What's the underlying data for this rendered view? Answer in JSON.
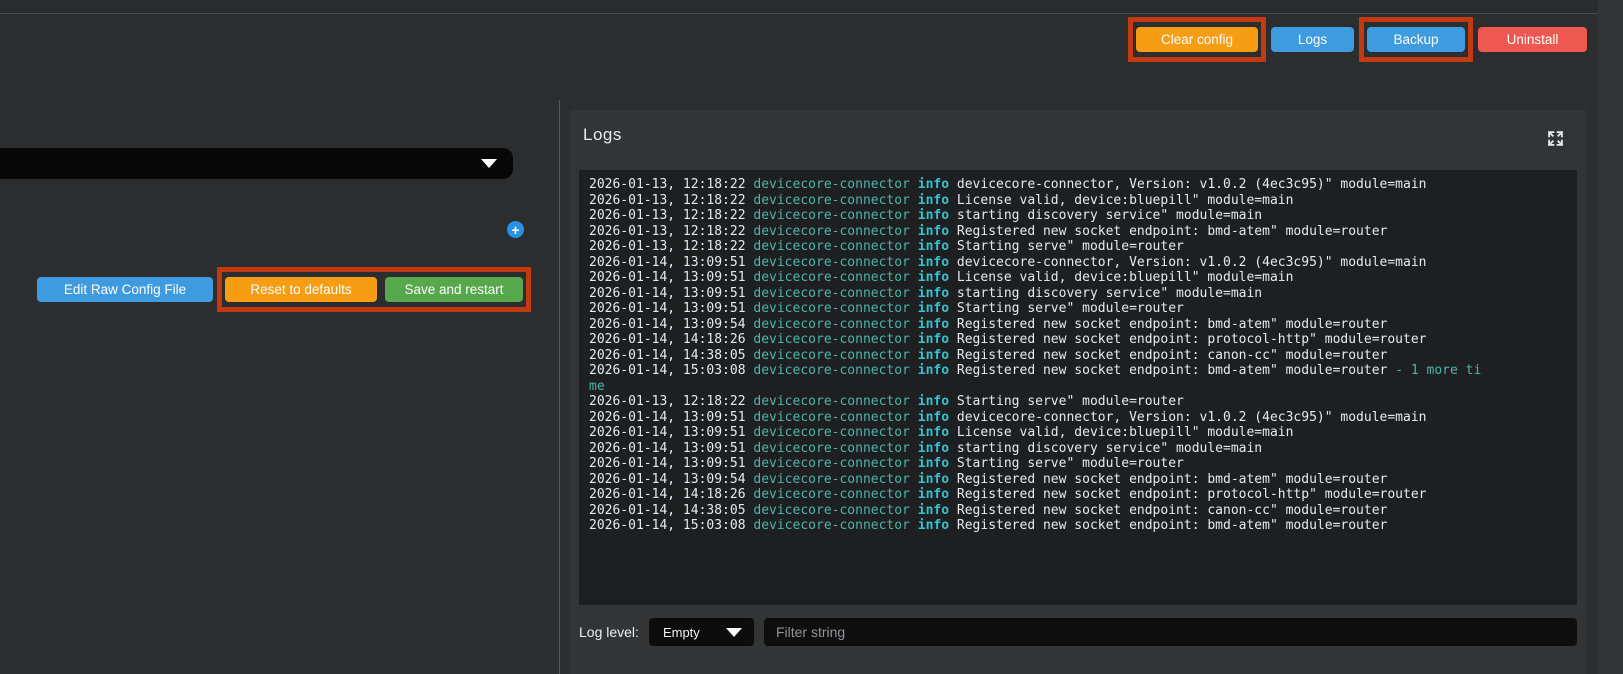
{
  "topbar": {
    "buttons": [
      {
        "label": "Clear config",
        "color": "#f79d13",
        "annotated": true
      },
      {
        "label": "Logs",
        "color": "#3f9be0",
        "annotated": false
      },
      {
        "label": "Backup",
        "color": "#3f9be0",
        "annotated": true
      },
      {
        "label": "Uninstall",
        "color": "#ef5850",
        "annotated": false
      }
    ]
  },
  "config": {
    "dropdown_icon": "chevron-down-icon",
    "add_icon": "plus-icon",
    "add_symbol": "+",
    "actions": [
      {
        "label": "Edit Raw Config File",
        "color": "#3f9be0",
        "annotated": false
      },
      {
        "label": "Reset to defaults",
        "color": "#f79d13",
        "annotated": true
      },
      {
        "label": "Save and restart",
        "color": "#57a84c",
        "annotated": true
      }
    ]
  },
  "logs": {
    "title": "Logs",
    "expand_icon": "expand-arrows-icon",
    "level_label": "Log level:",
    "level_value": "Empty",
    "filter_placeholder": "Filter string",
    "entries": [
      {
        "ts": "2026-01-13, 12:18:22",
        "src": "devicecore-connector",
        "lvl": "info",
        "msg": "devicecore-connector, Version: v1.0.2 (4ec3c95)\" module=main"
      },
      {
        "ts": "2026-01-13, 12:18:22",
        "src": "devicecore-connector",
        "lvl": "info",
        "msg": "License valid, device:bluepill\" module=main"
      },
      {
        "ts": "2026-01-13, 12:18:22",
        "src": "devicecore-connector",
        "lvl": "info",
        "msg": "starting discovery service\" module=main"
      },
      {
        "ts": "2026-01-13, 12:18:22",
        "src": "devicecore-connector",
        "lvl": "info",
        "msg": "Registered new socket endpoint: bmd-atem\" module=router"
      },
      {
        "ts": "2026-01-13, 12:18:22",
        "src": "devicecore-connector",
        "lvl": "info",
        "msg": "Starting serve\" module=router"
      },
      {
        "ts": "2026-01-14, 13:09:51",
        "src": "devicecore-connector",
        "lvl": "info",
        "msg": "devicecore-connector, Version: v1.0.2 (4ec3c95)\" module=main"
      },
      {
        "ts": "2026-01-14, 13:09:51",
        "src": "devicecore-connector",
        "lvl": "info",
        "msg": "License valid, device:bluepill\" module=main"
      },
      {
        "ts": "2026-01-14, 13:09:51",
        "src": "devicecore-connector",
        "lvl": "info",
        "msg": "starting discovery service\" module=main"
      },
      {
        "ts": "2026-01-14, 13:09:51",
        "src": "devicecore-connector",
        "lvl": "info",
        "msg": "Starting serve\" module=router"
      },
      {
        "ts": "2026-01-14, 13:09:54",
        "src": "devicecore-connector",
        "lvl": "info",
        "msg": "Registered new socket endpoint: bmd-atem\" module=router"
      },
      {
        "ts": "2026-01-14, 14:18:26",
        "src": "devicecore-connector",
        "lvl": "info",
        "msg": "Registered new socket endpoint: protocol-http\" module=router"
      },
      {
        "ts": "2026-01-14, 14:38:05",
        "src": "devicecore-connector",
        "lvl": "info",
        "msg": "Registered new socket endpoint: canon-cc\" module=router"
      },
      {
        "ts": "2026-01-14, 15:03:08",
        "src": "devicecore-connector",
        "lvl": "info",
        "msg": "Registered new socket endpoint: bmd-atem\" module=router",
        "extra": "- 1 more ti"
      },
      {
        "cont": "me"
      },
      {
        "ts": "2026-01-13, 12:18:22",
        "src": "devicecore-connector",
        "lvl": "info",
        "msg": "Starting serve\" module=router"
      },
      {
        "ts": "2026-01-14, 13:09:51",
        "src": "devicecore-connector",
        "lvl": "info",
        "msg": "devicecore-connector, Version: v1.0.2 (4ec3c95)\" module=main"
      },
      {
        "ts": "2026-01-14, 13:09:51",
        "src": "devicecore-connector",
        "lvl": "info",
        "msg": "License valid, device:bluepill\" module=main"
      },
      {
        "ts": "2026-01-14, 13:09:51",
        "src": "devicecore-connector",
        "lvl": "info",
        "msg": "starting discovery service\" module=main"
      },
      {
        "ts": "2026-01-14, 13:09:51",
        "src": "devicecore-connector",
        "lvl": "info",
        "msg": "Starting serve\" module=router"
      },
      {
        "ts": "2026-01-14, 13:09:54",
        "src": "devicecore-connector",
        "lvl": "info",
        "msg": "Registered new socket endpoint: bmd-atem\" module=router"
      },
      {
        "ts": "2026-01-14, 14:18:26",
        "src": "devicecore-connector",
        "lvl": "info",
        "msg": "Registered new socket endpoint: protocol-http\" module=router"
      },
      {
        "ts": "2026-01-14, 14:38:05",
        "src": "devicecore-connector",
        "lvl": "info",
        "msg": "Registered new socket endpoint: canon-cc\" module=router"
      },
      {
        "ts": "2026-01-14, 15:03:08",
        "src": "devicecore-connector",
        "lvl": "info",
        "msg": "Registered new socket endpoint: bmd-atem\" module=router"
      }
    ]
  },
  "colors": {
    "annotation_red": "#c43a10",
    "accent_blue": "#3f9be0",
    "accent_orange": "#f79d13",
    "accent_green": "#57a84c",
    "accent_red": "#ef5850",
    "log_source_teal": "#4fb4aa",
    "log_info_cyan": "#36c3cf",
    "page_background": "#2b2d2f",
    "panel_background": "#323436",
    "log_background": "#1d1f20"
  }
}
